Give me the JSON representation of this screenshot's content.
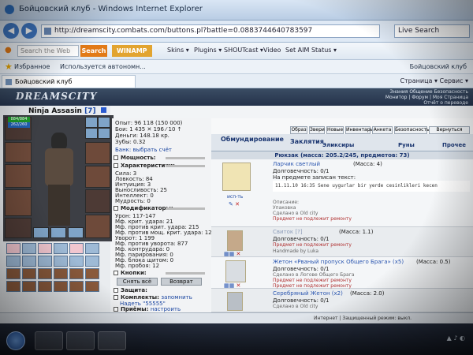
{
  "window": {
    "title": "Бойцовский клуб - Windows Internet Explorer",
    "url": "http://dreamscity.combats.com/buttons.pl?battle=0.0883744640783597",
    "search_placeholder": "Live Search"
  },
  "toolbar": {
    "web_search_placeholder": "Search the Web",
    "search_label": "Search",
    "winamp_label": "WINAMP",
    "items": [
      "Skins ▾",
      "Plugins ▾",
      "SHOUTcast ▾",
      "Video",
      "Set AIM Status ▾"
    ]
  },
  "favorites": {
    "label": "Избранное",
    "page": "Используется автономн...",
    "right": "Бойцовский клуб"
  },
  "tab": {
    "label": "Бойцовский клуб",
    "tools": "Страница ▾   Сервис ▾"
  },
  "game": {
    "logo": "DREAMSCITY",
    "nav_lines": [
      "Знания  Общение  Безопасность",
      "Монитор | Форум | Моя Страница",
      "Отчёт о переводе"
    ]
  },
  "character": {
    "name": "Ninja Assasin",
    "level": "[7]",
    "hp": "884/884",
    "mp": "262/260"
  },
  "stats": {
    "experience": "Опыт: 96 118 (150 000)",
    "battles": "Бои: 1 435 ✕ 196 ⁄ 10 ↑",
    "money": "Деньги: 148.18 кр.",
    "teeth": "Зубы: 0.32",
    "bank": "Банк: выбрать счёт",
    "power_hdr": "Мощность:",
    "char_hdr": "Характеристики:",
    "strength": "Сила: 3",
    "agility": "Ловкость: 84",
    "intuition": "Интуиция: 3",
    "endurance": "Выносливость: 25",
    "intellect": "Интеллект: 0",
    "wisdom": "Мудрость: 0",
    "mods_hdr": "Модификаторы:",
    "damage": "Урон: 117-147",
    "mf_crit": "Мф. крит. удара: 21",
    "mf_anticrit": "Мф. против крит. удара: 215",
    "mf_anticrit2": "Мф. против мощ. крит. удара: 12",
    "dodge": "Уворот: 1 199",
    "mf_antidodge": "Мф. против уворота: 877",
    "counter": "Мф. контрудара: 0",
    "parry": "Мф. парирования: 0",
    "block": "Мф. блока щитом: 0",
    "pierce": "Мф. пробоя: 12",
    "buttons_hdr": "Кнопки:",
    "take_off_all": "Снять всё",
    "return": "Возврат",
    "protection_hdr": "Защита:",
    "sets_hdr": "Комплекты:",
    "sets_link": "запомнить",
    "set_name": "Надеть \"55555\"",
    "techniques_hdr": "Приёмы:",
    "techniques_link": "настроить",
    "tech_set": "Набор \"оуыы\""
  },
  "right": {
    "top_links": [
      "Образ",
      "Звери",
      "Новые",
      "Инвентарь",
      "Анкета",
      "Безопасность",
      "Вернуться"
    ],
    "tabs": [
      "Обмундирование",
      "Заклятия"
    ],
    "subtabs": [
      "Эликсиры",
      "Руны",
      "Прочее"
    ],
    "backpack": "Рюкзак (масса: 205.2/245, предметов: 73)"
  },
  "items": [
    {
      "caption": "исп-ть",
      "title": "Ларчик светлый",
      "mass": "(Масса: 4)",
      "durability": "Долговечность: 0/1",
      "inscribed": "На предмете записан текст:",
      "inscription": "11.11.10 16:35 Sene uygurlar bir yerde cesinlikleri kecen",
      "description": "Описание:",
      "packing": "Упаковка",
      "made_in": "Сделано в Old city",
      "note": "Предмет не подлежит ремонту"
    },
    {
      "title": "Свиток [?]",
      "mass": "(Масса: 1.1)",
      "durability": "Долговечность: 0/1",
      "note": "Предмет не подлежит ремонту",
      "made_in": "Handmade by Luka"
    },
    {
      "title": "Жетон «Рваный пропуск Общего Брага» (x5)",
      "mass": "(Масса: 0.5)",
      "durability": "Долговечность: 0/1",
      "made_in": "Сделано в Логове Общего Брага",
      "note": "Предмет не подлежит ремонту",
      "note2": "Предмет не подлежит ремонту"
    },
    {
      "title": "Серебряный Жетон (x2)",
      "mass": "(Масса: 2.0)",
      "durability": "Долговечность: 0/1",
      "made_in": "Сделано в Old city"
    }
  ],
  "statusbar": {
    "text": "Интернет | Защищенный режим: выкл."
  },
  "colors": {
    "accent": "#1a45a0",
    "header": "#24324a",
    "hp": "#1d9a2a",
    "mp": "#2061b4"
  }
}
